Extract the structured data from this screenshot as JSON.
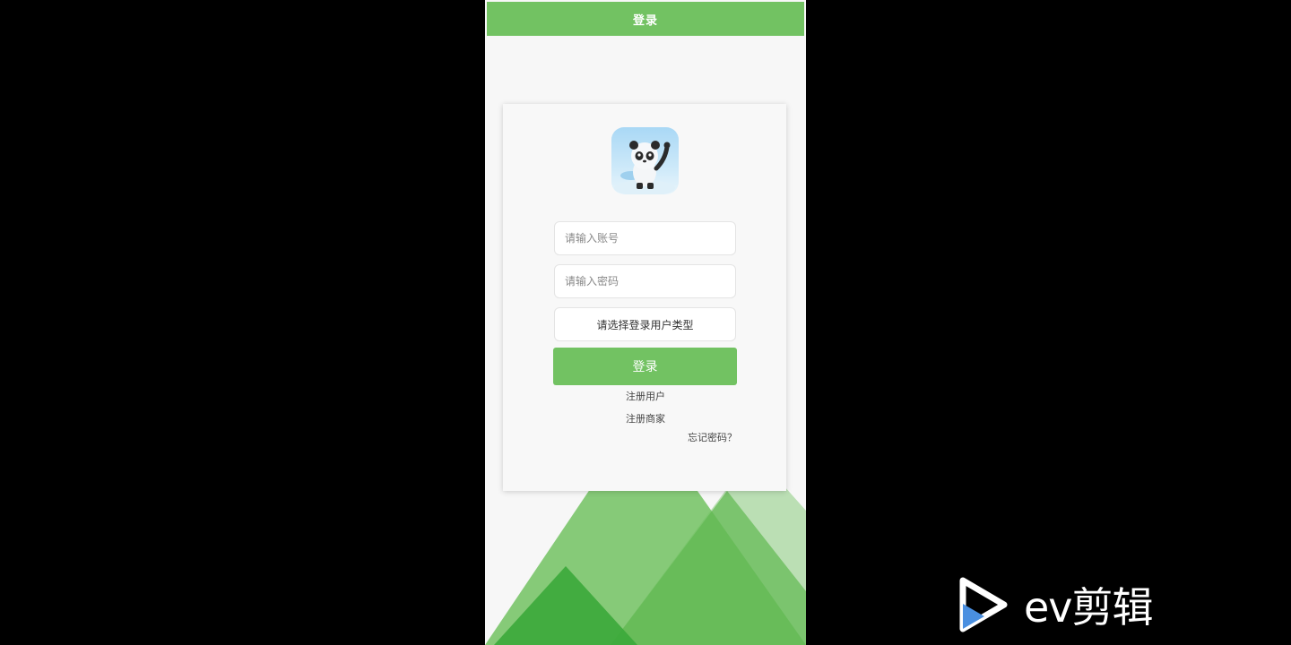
{
  "header": {
    "title": "登录"
  },
  "login": {
    "account_placeholder": "请输入账号",
    "password_placeholder": "请输入密码",
    "user_type_label": "请选择登录用户类型",
    "submit_label": "登录",
    "register_user_label": "注册用户",
    "register_merchant_label": "注册商家",
    "forgot_password_label": "忘记密码？"
  },
  "watermark": {
    "text": "ev剪辑",
    "icon": "play-logo-icon"
  },
  "colors": {
    "accent": "#72c262",
    "background": "#f7f7f7"
  }
}
